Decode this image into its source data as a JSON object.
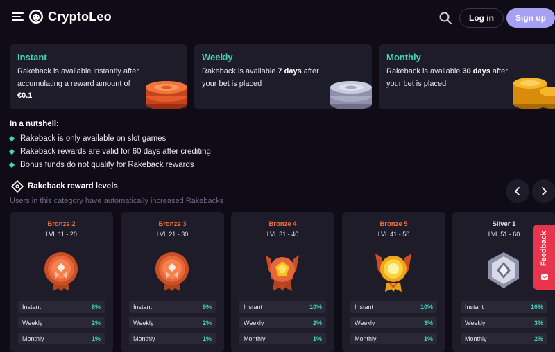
{
  "header": {
    "brand": "CryptoLeo",
    "login_label": "Log in",
    "signup_label": "Sign up"
  },
  "info_cards": [
    {
      "title": "Instant",
      "desc_pre": "Rakeback is available instantly after accumulating a reward amount of ",
      "desc_bold": "€0.1",
      "desc_post": "",
      "coin_color": "#e0562a"
    },
    {
      "title": "Weekly",
      "desc_pre": "Rakeback is available ",
      "desc_bold": "7 days",
      "desc_post": " after your bet is placed",
      "coin_color": "#b9bfd6"
    },
    {
      "title": "Monthly",
      "desc_pre": "Rakeback is available ",
      "desc_bold": "30 days",
      "desc_post": " after your bet is placed",
      "coin_color": "#f0a51a"
    }
  ],
  "nutshell": {
    "title": "In a nutshell:",
    "items": [
      "Rakeback is only available on slot games",
      "Rakeback rewards are valid for 60 days after crediting",
      "Bonus funds do not qualify for Rakeback rewards"
    ]
  },
  "levels": {
    "title": "Rakeback reward levels",
    "subtitle": "Users in this category have automatically increased Rakebacks",
    "rate_labels": [
      "Instant",
      "Weekly",
      "Monthly"
    ],
    "cards": [
      {
        "name": "Bronze 2",
        "lvl": "LVL 11 - 20",
        "rates": [
          "8%",
          "2%",
          "1%"
        ],
        "color": "#f0703a",
        "badge": "bronze"
      },
      {
        "name": "Bronze 3",
        "lvl": "LVL 21 - 30",
        "rates": [
          "9%",
          "2%",
          "1%"
        ],
        "color": "#f0703a",
        "badge": "bronze"
      },
      {
        "name": "Bronze 4",
        "lvl": "LVL 31 - 40",
        "rates": [
          "10%",
          "2%",
          "1%"
        ],
        "color": "#f0703a",
        "badge": "bronze-gem"
      },
      {
        "name": "Bronze 5",
        "lvl": "LVL 41 - 50",
        "rates": [
          "10%",
          "3%",
          "1%"
        ],
        "color": "#f0703a",
        "badge": "bronze-gold"
      },
      {
        "name": "Silver 1",
        "lvl": "LVL 51 - 60",
        "rates": [
          "10%",
          "3%",
          "2%"
        ],
        "color": "#e3e3ee",
        "badge": "silver"
      }
    ]
  },
  "feedback": {
    "label": "Feedback"
  },
  "colors": {
    "accent": "#3fd6ba",
    "signup": "#a6a0f4",
    "card": "#1f1c2a",
    "bg": "#0f0c17",
    "bronze": "#f0703a",
    "feedback": "#e8344d"
  }
}
